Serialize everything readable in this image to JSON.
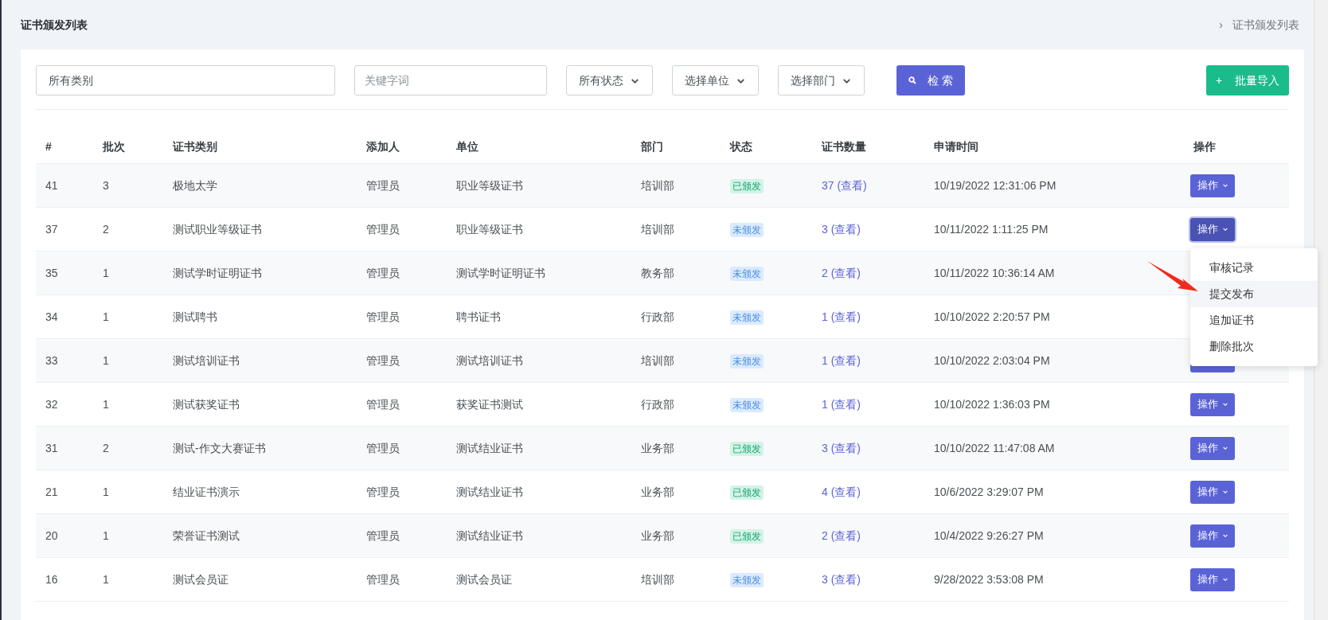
{
  "page_title": "证书颁发列表",
  "breadcrumb": {
    "separator": "›",
    "current": "证书颁发列表"
  },
  "filters": {
    "category": {
      "value": "所有类别"
    },
    "keyword": {
      "placeholder": "关键字词"
    },
    "selects": [
      {
        "label": "所有状态"
      },
      {
        "label": "选择单位"
      },
      {
        "label": "选择部门"
      }
    ],
    "search_button": "检 索",
    "import_button": {
      "icon": "+",
      "label": "批量导入"
    }
  },
  "table": {
    "columns": [
      "#",
      "批次",
      "证书类别",
      "添加人",
      "单位",
      "部门",
      "状态",
      "证书数量",
      "申请时间",
      "操作"
    ],
    "rows": [
      {
        "id": "41",
        "batch": "3",
        "category": "极地太学",
        "creator": "管理员",
        "unit": "职业等级证书",
        "dept": "培训部",
        "status": {
          "label": "已颁发",
          "kind": "issued"
        },
        "count": "37 (查看)",
        "time": "10/19/2022 12:31:06 PM",
        "action": "操作",
        "menu_open": false
      },
      {
        "id": "37",
        "batch": "2",
        "category": "测试职业等级证书",
        "creator": "管理员",
        "unit": "职业等级证书",
        "dept": "培训部",
        "status": {
          "label": "未颁发",
          "kind": "pending"
        },
        "count": "3 (查看)",
        "time": "10/11/2022 1:11:25 PM",
        "action": "操作",
        "menu_open": true
      },
      {
        "id": "35",
        "batch": "1",
        "category": "测试学时证明证书",
        "creator": "管理员",
        "unit": "测试学时证明证书",
        "dept": "教务部",
        "status": {
          "label": "未颁发",
          "kind": "pending"
        },
        "count": "2 (查看)",
        "time": "10/11/2022 10:36:14 AM"
      },
      {
        "id": "34",
        "batch": "1",
        "category": "测试聘书",
        "creator": "管理员",
        "unit": "聘书证书",
        "dept": "行政部",
        "status": {
          "label": "未颁发",
          "kind": "pending"
        },
        "count": "1 (查看)",
        "time": "10/10/2022 2:20:57 PM"
      },
      {
        "id": "33",
        "batch": "1",
        "category": "测试培训证书",
        "creator": "管理员",
        "unit": "测试培训证书",
        "dept": "培训部",
        "status": {
          "label": "未颁发",
          "kind": "pending"
        },
        "count": "1 (查看)",
        "time": "10/10/2022 2:03:04 PM",
        "menu_open": false
      },
      {
        "id": "32",
        "batch": "1",
        "category": "测试获奖证书",
        "creator": "管理员",
        "unit": "获奖证书测试",
        "dept": "行政部",
        "status": {
          "label": "未颁发",
          "kind": "pending"
        },
        "count": "1 (查看)",
        "time": "10/10/2022 1:36:03 PM",
        "action": "操作",
        "menu_open": false
      },
      {
        "id": "31",
        "batch": "2",
        "category": "测试-作文大赛证书",
        "creator": "管理员",
        "unit": "测试结业证书",
        "dept": "业务部",
        "status": {
          "label": "已颁发",
          "kind": "issued"
        },
        "count": "3 (查看)",
        "time": "10/10/2022 11:47:08 AM",
        "action": "操作",
        "menu_open": false
      },
      {
        "id": "21",
        "batch": "1",
        "category": "结业证书演示",
        "creator": "管理员",
        "unit": "测试结业证书",
        "dept": "业务部",
        "status": {
          "label": "已颁发",
          "kind": "issued"
        },
        "count": "4 (查看)",
        "time": "10/6/2022 3:29:07 PM",
        "action": "操作",
        "menu_open": false
      },
      {
        "id": "20",
        "batch": "1",
        "category": "荣誉证书测试",
        "creator": "管理员",
        "unit": "测试结业证书",
        "dept": "业务部",
        "status": {
          "label": "已颁发",
          "kind": "issued"
        },
        "count": "2 (查看)",
        "time": "10/4/2022 9:26:27 PM",
        "action": "操作",
        "menu_open": false
      },
      {
        "id": "16",
        "batch": "1",
        "category": "测试会员证",
        "creator": "管理员",
        "unit": "测试会员证",
        "dept": "培训部",
        "status": {
          "label": "未颁发",
          "kind": "pending"
        },
        "count": "3 (查看)",
        "time": "9/28/2022 3:53:08 PM",
        "action": "操作",
        "menu_open": false
      }
    ]
  },
  "action_menu": {
    "items": [
      {
        "label": "审核记录",
        "selected": false
      },
      {
        "label": "提交发布",
        "selected": true
      },
      {
        "label": "追加证书",
        "selected": false
      },
      {
        "label": "删除批次",
        "selected": false
      }
    ]
  }
}
